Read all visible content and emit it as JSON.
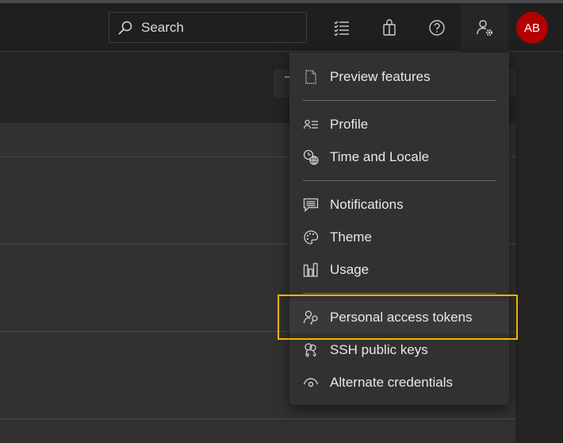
{
  "header": {
    "search_placeholder": "Search",
    "icons": [
      "work-items-icon",
      "marketplace-icon",
      "help-icon",
      "user-settings-icon"
    ],
    "avatar_initials": "AB"
  },
  "menu": {
    "items": [
      {
        "label": "Preview features",
        "icon": "document-icon"
      },
      {
        "label": "Profile",
        "icon": "contact-card-icon"
      },
      {
        "label": "Time and Locale",
        "icon": "time-globe-icon"
      },
      {
        "label": "Notifications",
        "icon": "comment-icon"
      },
      {
        "label": "Theme",
        "icon": "palette-icon"
      },
      {
        "label": "Usage",
        "icon": "bar-chart-icon"
      },
      {
        "label": "Personal access tokens",
        "icon": "person-key-icon"
      },
      {
        "label": "SSH public keys",
        "icon": "keys-icon"
      },
      {
        "label": "Alternate credentials",
        "icon": "eye-icon"
      }
    ],
    "highlighted_item": "Personal access tokens"
  },
  "colors": {
    "accent_highlight": "#f5b400",
    "avatar_bg": "#b30000",
    "menu_bg": "#323130",
    "header_bg": "#1f1f1f"
  }
}
